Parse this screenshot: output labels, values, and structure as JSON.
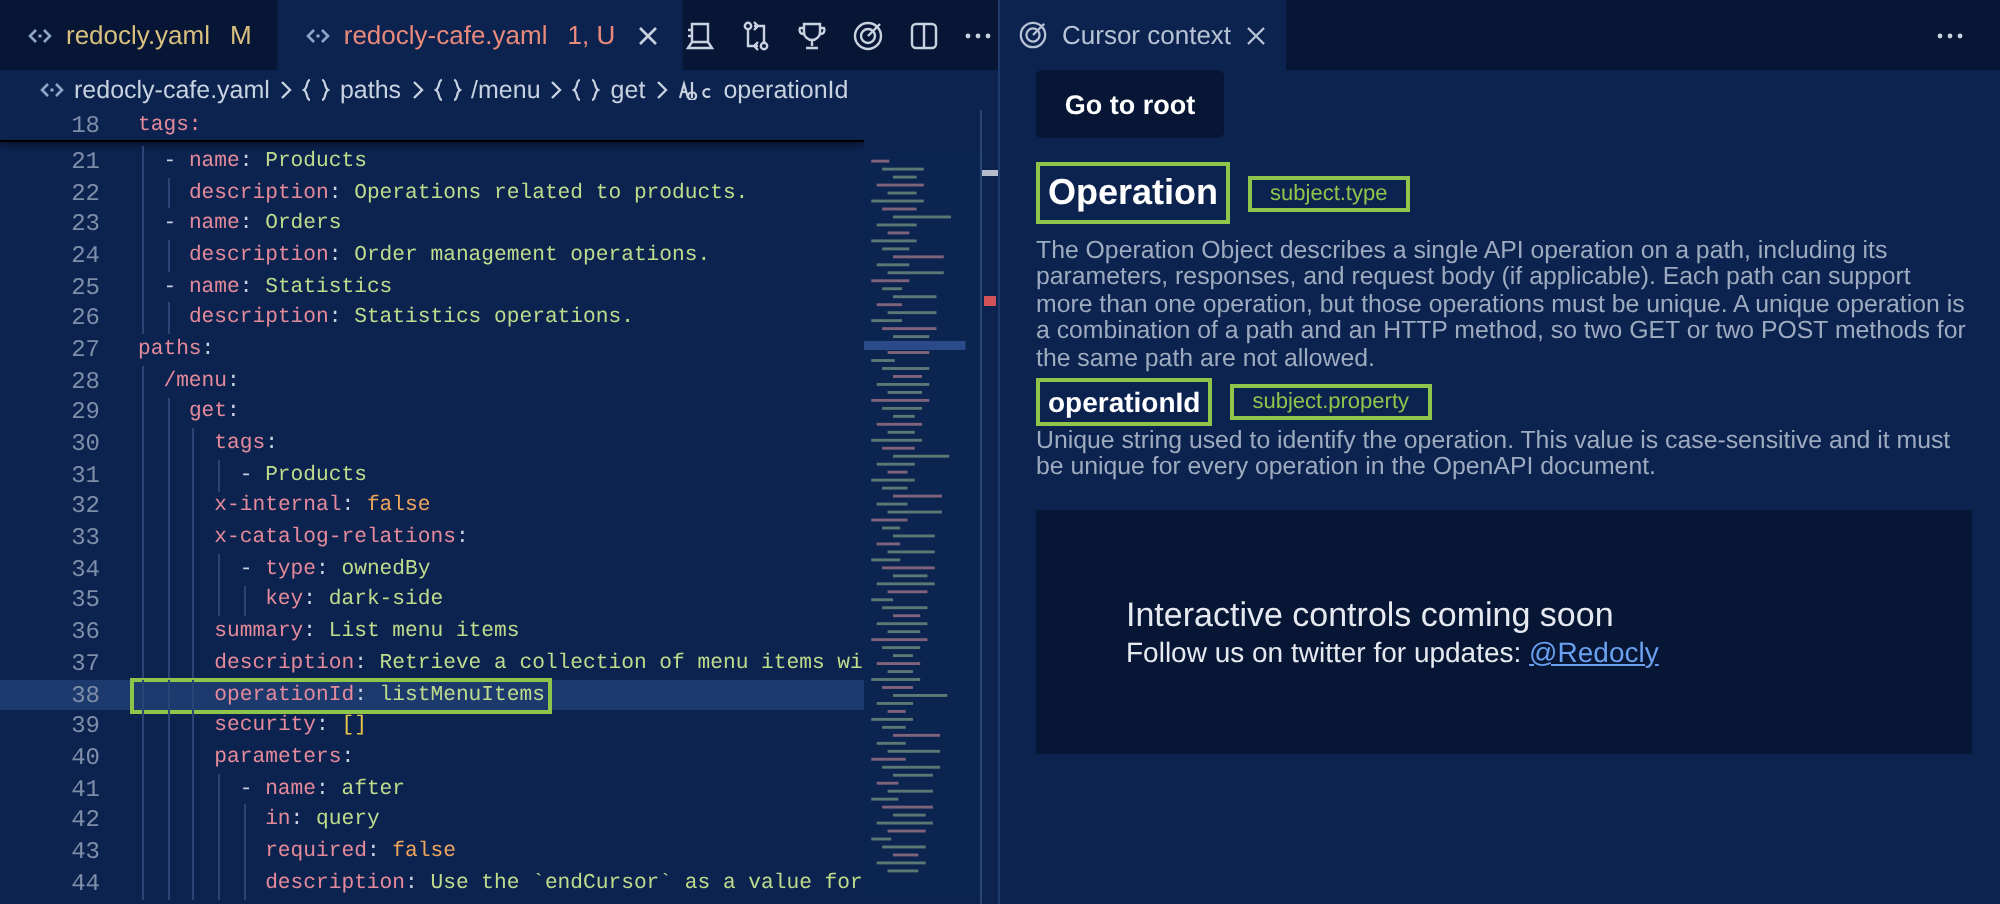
{
  "editor": {
    "tabs": [
      {
        "label": "redocly.yaml",
        "badge": "M",
        "selected": false
      },
      {
        "label": "redocly-cafe.yaml",
        "badge": "1, U",
        "selected": true
      }
    ],
    "breadcrumb": [
      {
        "label": "redocly-cafe.yaml",
        "kind": "file"
      },
      {
        "label": "paths",
        "kind": "object"
      },
      {
        "label": "/menu",
        "kind": "object"
      },
      {
        "label": "get",
        "kind": "object"
      },
      {
        "label": "operationId",
        "kind": "string"
      }
    ],
    "sticky_line": {
      "number": "18",
      "code": "tags:"
    },
    "lines": [
      {
        "number": "21",
        "code": "  - name: Products",
        "kind": "string",
        "highlighted": false
      },
      {
        "number": "22",
        "code": "    description: Operations related to products.",
        "kind": "string",
        "highlighted": false
      },
      {
        "number": "23",
        "code": "  - name: Orders",
        "kind": "string",
        "highlighted": false
      },
      {
        "number": "24",
        "code": "    description: Order management operations.",
        "kind": "string",
        "highlighted": false
      },
      {
        "number": "25",
        "code": "  - name: Statistics",
        "kind": "string",
        "highlighted": false
      },
      {
        "number": "26",
        "code": "    description: Statistics operations.",
        "kind": "string",
        "highlighted": false
      },
      {
        "number": "27",
        "code": "paths:",
        "kind": "string",
        "highlighted": false
      },
      {
        "number": "28",
        "code": "  /menu:",
        "kind": "string",
        "highlighted": false
      },
      {
        "number": "29",
        "code": "    get:",
        "kind": "string",
        "highlighted": false
      },
      {
        "number": "30",
        "code": "      tags:",
        "kind": "string",
        "highlighted": false
      },
      {
        "number": "31",
        "code": "        - Products",
        "kind": "string",
        "highlighted": false
      },
      {
        "number": "32",
        "code": "      x-internal: false",
        "kind": "literal",
        "highlighted": false
      },
      {
        "number": "33",
        "code": "      x-catalog-relations:",
        "kind": "string",
        "highlighted": false
      },
      {
        "number": "34",
        "code": "        - type: ownedBy",
        "kind": "string",
        "highlighted": false
      },
      {
        "number": "35",
        "code": "          key: dark-side",
        "kind": "string",
        "highlighted": false
      },
      {
        "number": "36",
        "code": "      summary: List menu items",
        "kind": "string",
        "highlighted": false
      },
      {
        "number": "37",
        "code": "      description: Retrieve a collection of menu items wi",
        "kind": "string",
        "highlighted": false
      },
      {
        "number": "38",
        "code": "      operationId: listMenuItems",
        "kind": "string",
        "highlighted": true
      },
      {
        "number": "39",
        "code": "      security: []",
        "kind": "bracket",
        "highlighted": false
      },
      {
        "number": "40",
        "code": "      parameters:",
        "kind": "string",
        "highlighted": false
      },
      {
        "number": "41",
        "code": "        - name: after",
        "kind": "string",
        "highlighted": false
      },
      {
        "number": "42",
        "code": "          in: query",
        "kind": "string",
        "highlighted": false
      },
      {
        "number": "43",
        "code": "          required: false",
        "kind": "literal",
        "highlighted": false
      },
      {
        "number": "44",
        "code": "          description: Use the `endCursor` as a value for",
        "kind": "string",
        "highlighted": false
      }
    ]
  },
  "panel": {
    "tab": {
      "label": "Cursor context",
      "selected": true
    },
    "button": "Go to root",
    "sections": [
      {
        "title": "Operation",
        "tag": "subject.type",
        "kind": "type",
        "description": "The Operation Object describes a single API operation on a path, including its parameters, responses, and request body (if applicable). Each path can support more than one operation, but those operations must be unique. A unique operation is a combination of a path and an HTTP method, so two GET or two POST methods for the same path are not allowed."
      },
      {
        "title": "operationId",
        "tag": "subject.property",
        "kind": "property",
        "description": "Unique string used to identify the operation. This value is case-sensitive and it must be unique for every operation in the OpenAPI document."
      }
    ],
    "notice": {
      "title": "Interactive controls coming soon",
      "text": "Follow us on twitter for updates:",
      "link": "@Redocly"
    }
  }
}
